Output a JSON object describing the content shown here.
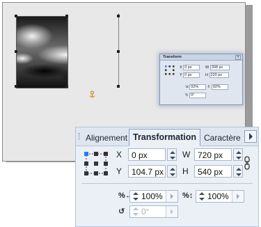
{
  "canvas": {
    "photo_alt": "cloudy sky photo"
  },
  "mini_palette": {
    "title": "Transform",
    "x_label": "X",
    "x_value": "0 px",
    "w_label": "W",
    "w_value": "308 px",
    "y_label": "Y",
    "y_value": "0 px",
    "h_label": "H",
    "h_value": "220 px",
    "scale_w_value": "92%",
    "scale_h_value": "92%",
    "rotation_value": "0°"
  },
  "panel": {
    "tabs": [
      {
        "label": "Alignement"
      },
      {
        "label": "Transformation"
      },
      {
        "label": "Caractère"
      }
    ],
    "x_label": "X",
    "x_value": "0 px",
    "y_label": "Y",
    "y_value": "104.7 px",
    "w_label": "W",
    "w_value": "720 px",
    "h_label": "H",
    "h_value": "540 px",
    "scale_w_value": "100%",
    "scale_h_value": "100%",
    "rotation_value": "0°"
  },
  "icons": {
    "reference_point": "reference-point-grid-icon",
    "link": "chain-link-icon",
    "scale_width": "scale-width-icon",
    "scale_height": "scale-height-icon",
    "rotate": "rotate-icon",
    "anchor": "anchor-icon"
  },
  "colors": {
    "panel_bg": "#ebf0f6",
    "tab_bar": "#dfe6ef",
    "border": "#b4c3d8",
    "accent": "#2b7de9"
  }
}
